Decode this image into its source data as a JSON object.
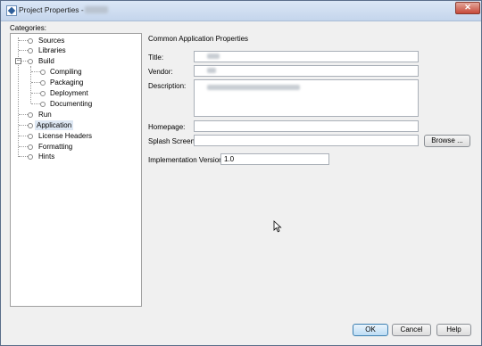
{
  "window": {
    "title": "Project Properties -"
  },
  "categories": {
    "label": "Categories:",
    "items": [
      {
        "label": "Sources"
      },
      {
        "label": "Libraries"
      },
      {
        "label": "Build"
      },
      {
        "label": "Compiling"
      },
      {
        "label": "Packaging"
      },
      {
        "label": "Deployment"
      },
      {
        "label": "Documenting"
      },
      {
        "label": "Run"
      },
      {
        "label": "Application",
        "selected": true
      },
      {
        "label": "License Headers"
      },
      {
        "label": "Formatting"
      },
      {
        "label": "Hints"
      }
    ]
  },
  "main": {
    "section_title": "Common Application Properties",
    "title_label": "Title:",
    "vendor_label": "Vendor:",
    "description_label": "Description:",
    "homepage_label": "Homepage:",
    "splash_label": "Splash Screen:",
    "browse_label": "Browse ...",
    "impl_version_label": "Implementation Version:",
    "impl_version_value": "1.0"
  },
  "footer": {
    "ok_label": "OK",
    "cancel_label": "Cancel",
    "help_label": "Help"
  },
  "colors": {
    "selection": "#dde7f3",
    "default_button_border": "#3c7fb1",
    "close_button": "#c7493a"
  }
}
